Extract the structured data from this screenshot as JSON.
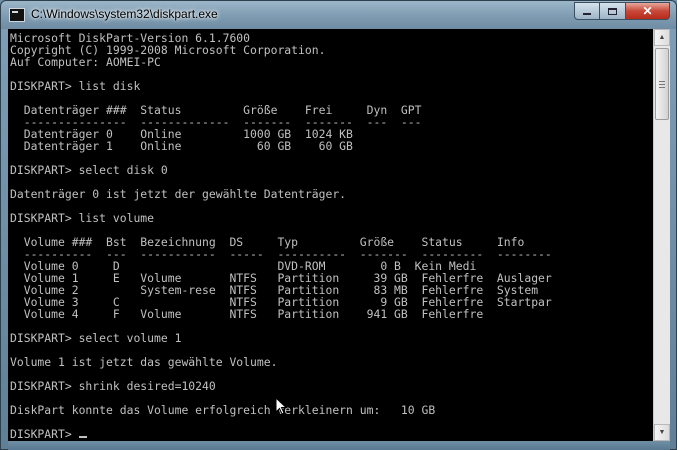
{
  "window": {
    "title": "C:\\Windows\\system32\\diskpart.exe",
    "controls": {
      "minimize": "minimize",
      "maximize": "maximize",
      "close": "✕"
    }
  },
  "console": {
    "text": "Microsoft DiskPart-Version 6.1.7600\nCopyright (C) 1999-2008 Microsoft Corporation.\nAuf Computer: AOMEI-PC\n\nDISKPART> list disk\n\n  Datenträger ###  Status         Größe    Frei     Dyn  GPT\n  ---------------  -------------  -------  -------  ---  ---\n  Datenträger 0    Online         1000 GB  1024 KB\n  Datenträger 1    Online           60 GB    60 GB\n\nDISKPART> select disk 0\n\nDatenträger 0 ist jetzt der gewählte Datenträger.\n\nDISKPART> list volume\n\n  Volume ###  Bst  Bezeichnung  DS     Typ         Größe    Status     Info\n  ----------  ---  -----------  -----  ----------  -------  ---------  --------\n  Volume 0     D                       DVD-ROM        0 B  Kein Medi\n  Volume 1     E   Volume       NTFS   Partition     39 GB  Fehlerfre  Auslager\n  Volume 2         System-rese  NTFS   Partition     83 MB  Fehlerfre  System\n  Volume 3     C                NTFS   Partition      9 GB  Fehlerfre  Startpar\n  Volume 4     F   Volume       NTFS   Partition    941 GB  Fehlerfre\n\nDISKPART> select volume 1\n\nVolume 1 ist jetzt das gewählte Volume.\n\nDISKPART> shrink desired=10240\n\nDiskPart konnte das Volume erfolgreich verkleinern um:   10 GB\n\n",
    "prompt": "DISKPART> "
  },
  "scrollbar": {
    "up_arrow": "▲",
    "down_arrow": "▼"
  },
  "colors": {
    "console_background": "#000000",
    "console_text": "#c0c0c0",
    "close_button": "#c8483a",
    "frame": "#7e9bb1"
  }
}
